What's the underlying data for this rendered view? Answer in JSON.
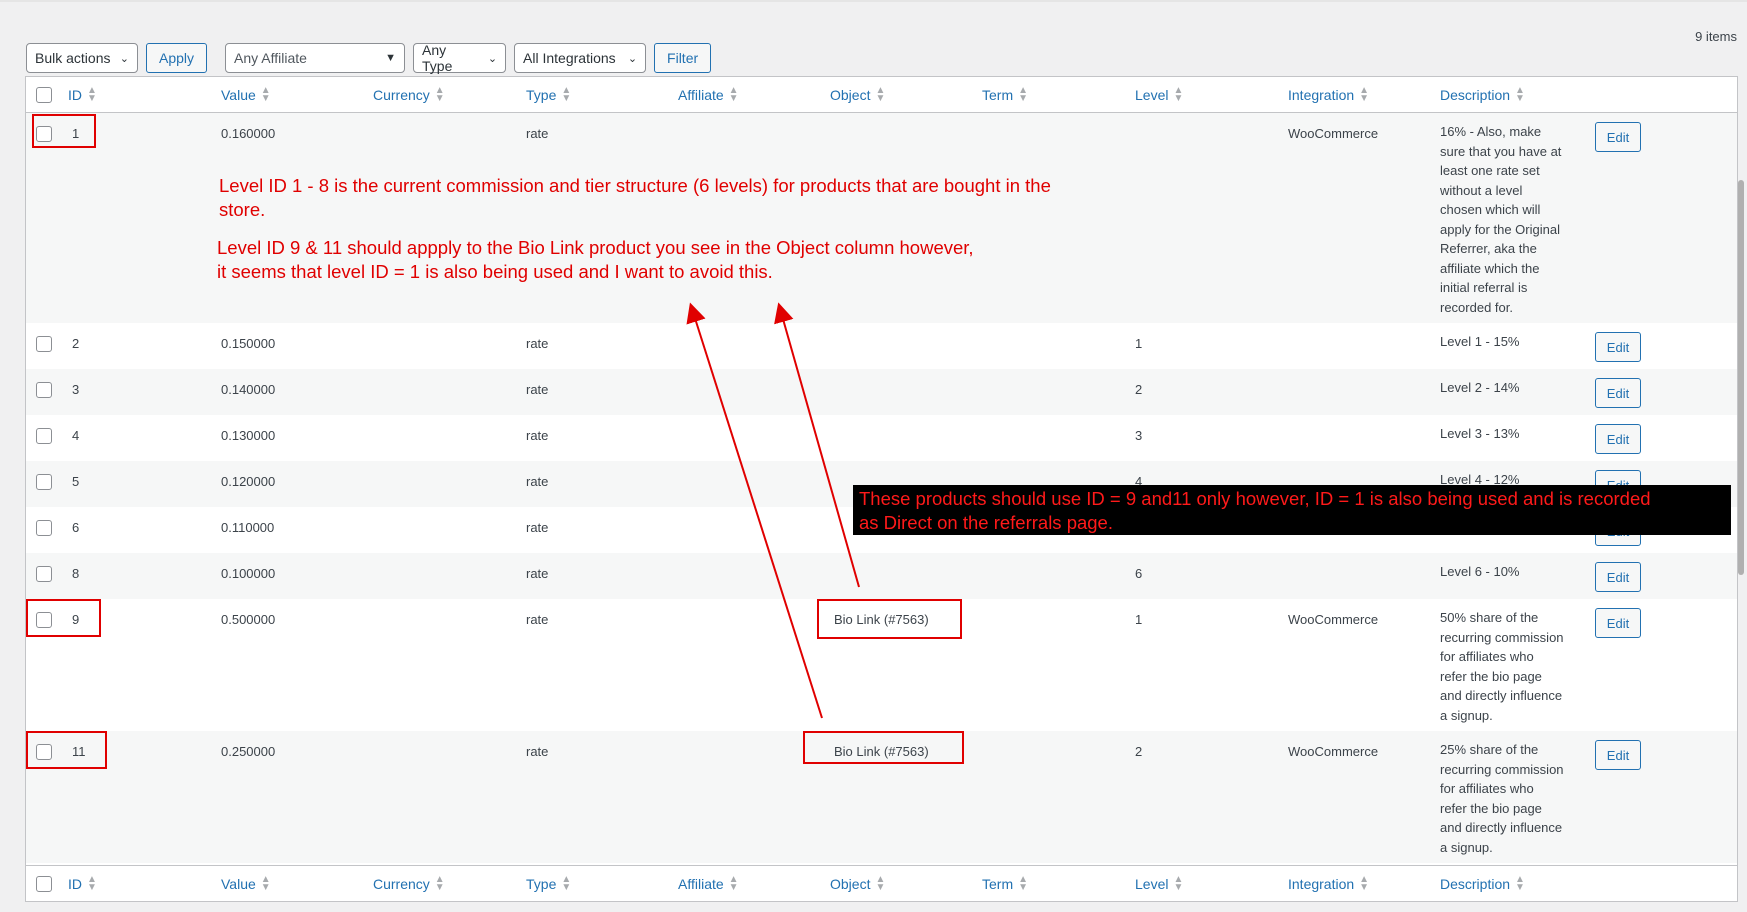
{
  "items_count": "9 items",
  "toolbar": {
    "bulk_actions": "Bulk actions",
    "apply": "Apply",
    "affiliate_filter": "Any Affiliate",
    "type_filter": "Any Type",
    "integration_filter": "All Integrations",
    "filter": "Filter"
  },
  "columns": [
    "ID",
    "Value",
    "Currency",
    "Type",
    "Affiliate",
    "Object",
    "Term",
    "Level",
    "Integration",
    "Description"
  ],
  "rows": [
    {
      "id": "1",
      "value": "0.160000",
      "type": "rate",
      "object": "",
      "level": "",
      "integration": "WooCommerce",
      "description": [
        "16% - Also, make",
        "sure that you have at",
        "least one rate set",
        "without a level",
        "chosen which will",
        "apply for the Original",
        "Referrer, aka the",
        "affiliate which the",
        "initial referral is",
        "recorded for."
      ],
      "edit": "Edit"
    },
    {
      "id": "2",
      "value": "0.150000",
      "type": "rate",
      "object": "",
      "level": "1",
      "integration": "",
      "description": [
        "Level 1 - 15%"
      ],
      "edit": "Edit"
    },
    {
      "id": "3",
      "value": "0.140000",
      "type": "rate",
      "object": "",
      "level": "2",
      "integration": "",
      "description": [
        "Level 2 - 14%"
      ],
      "edit": "Edit"
    },
    {
      "id": "4",
      "value": "0.130000",
      "type": "rate",
      "object": "",
      "level": "3",
      "integration": "",
      "description": [
        "Level 3 - 13%"
      ],
      "edit": "Edit"
    },
    {
      "id": "5",
      "value": "0.120000",
      "type": "rate",
      "object": "",
      "level": "4",
      "integration": "",
      "description": [
        "Level 4 - 12%"
      ],
      "edit": "Edit"
    },
    {
      "id": "6",
      "value": "0.110000",
      "type": "rate",
      "object": "",
      "level": "",
      "integration": "",
      "description": [
        ""
      ],
      "edit": "Edit"
    },
    {
      "id": "8",
      "value": "0.100000",
      "type": "rate",
      "object": "",
      "level": "6",
      "integration": "",
      "description": [
        "Level 6 - 10%"
      ],
      "edit": "Edit"
    },
    {
      "id": "9",
      "value": "0.500000",
      "type": "rate",
      "object": "Bio Link (#7563)",
      "level": "1",
      "integration": "WooCommerce",
      "description": [
        "50% share of the",
        "recurring commission",
        "for affiliates who",
        "refer the bio page",
        "and directly influence",
        "a signup."
      ],
      "edit": "Edit"
    },
    {
      "id": "11",
      "value": "0.250000",
      "type": "rate",
      "object": "Bio Link (#7563)",
      "level": "2",
      "integration": "WooCommerce",
      "description": [
        "25% share of the",
        "recurring commission",
        "for affiliates who",
        "refer the bio page",
        "and directly influence",
        "a signup."
      ],
      "edit": "Edit"
    }
  ],
  "annotations": {
    "note1_line1": "Level ID 1 - 8 is the current commission and tier structure (6 levels) for products that are bought in the",
    "note1_line2": "store.",
    "note2_line1": "Level ID 9 & 11 should appply to the Bio Link product you see in the Object column however,",
    "note2_line2": "it seems that level ID = 1 is also being used and I want to avoid this.",
    "box_line1": "These products should use ID = 9 and11 only however, ID = 1 is also being used and is recorded",
    "box_line2": "as Direct on the referrals page."
  },
  "colors": {
    "accent": "#2271b1",
    "annotation": "#e00000"
  }
}
